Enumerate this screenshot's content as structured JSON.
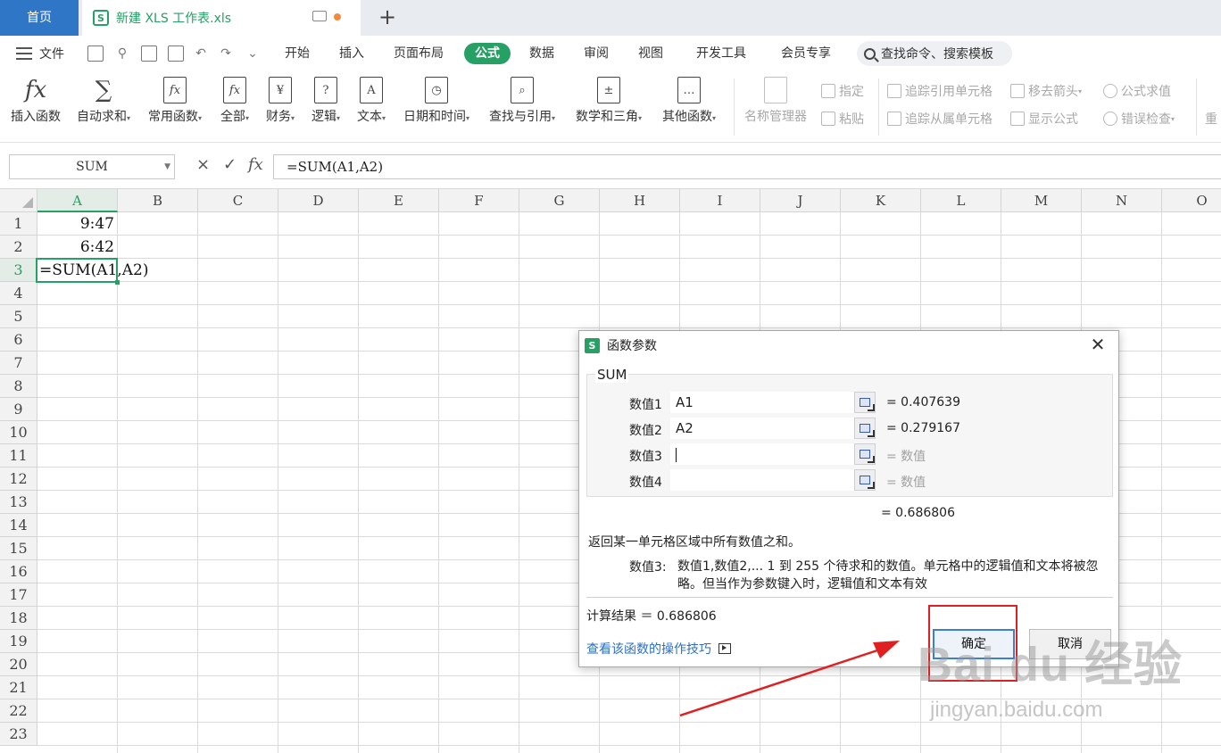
{
  "titlebar": {
    "home_tab": "首页",
    "doc_tab": "新建 XLS 工作表.xls",
    "doc_icon_letter": "S",
    "new_tab_symbol": "+"
  },
  "menu": {
    "file_label": "文件",
    "tabs": [
      "开始",
      "插入",
      "页面布局",
      "公式",
      "数据",
      "审阅",
      "视图",
      "开发工具",
      "会员专享"
    ],
    "active_tab": "公式",
    "search_placeholder": "查找命令、搜索模板"
  },
  "ribbon": {
    "buttons": [
      {
        "label": "插入函数",
        "icon": "fx-icon",
        "glyph": "fx"
      },
      {
        "label": "自动求和",
        "icon": "sigma-icon",
        "glyph": "∑"
      },
      {
        "label": "常用函数",
        "icon": "star-function-icon",
        "glyph": "fx"
      },
      {
        "label": "全部",
        "icon": "function-book-icon",
        "glyph": "fx"
      },
      {
        "label": "财务",
        "icon": "yen-book-icon",
        "glyph": "¥"
      },
      {
        "label": "逻辑",
        "icon": "question-book-icon",
        "glyph": "?"
      },
      {
        "label": "文本",
        "icon": "text-book-icon",
        "glyph": "A"
      },
      {
        "label": "日期和时间",
        "icon": "clock-book-icon",
        "glyph": "◷"
      },
      {
        "label": "查找与引用",
        "icon": "magnifier-book-icon",
        "glyph": "⌕"
      },
      {
        "label": "数学和三角",
        "icon": "math-book-icon",
        "glyph": "±"
      },
      {
        "label": "其他函数",
        "icon": "dots-book-icon",
        "glyph": "…"
      }
    ],
    "name_manager": "名称管理器",
    "specify": "指定",
    "paste": "粘贴",
    "trace_precedents": "追踪引用单元格",
    "trace_dependents": "追踪从属单元格",
    "remove_arrows": "移去箭头",
    "show_formulas": "显示公式",
    "evaluate_formula": "公式求值",
    "error_check": "错误检查",
    "recalc_partial": "重"
  },
  "formula_bar": {
    "name_box": "SUM",
    "cancel_symbol": "×",
    "confirm_symbol": "✓",
    "fx_symbol": "fx",
    "formula": "=SUM(A1,A2)"
  },
  "sheet": {
    "columns": [
      "A",
      "B",
      "C",
      "D",
      "E",
      "F",
      "G",
      "H",
      "I",
      "J",
      "K",
      "L",
      "M",
      "N",
      "O"
    ],
    "rows": [
      "1",
      "2",
      "3",
      "4",
      "5",
      "6",
      "7",
      "8",
      "9",
      "10",
      "11",
      "12",
      "13",
      "14",
      "15",
      "16",
      "17",
      "18",
      "19",
      "20",
      "21",
      "22",
      "23"
    ],
    "cells": {
      "A1": "9:47",
      "A2": "6:42",
      "A3": "=SUM(A1,A2)"
    }
  },
  "dialog": {
    "title": "函数参数",
    "function_name": "SUM",
    "args": [
      {
        "label": "数值1",
        "value": "A1",
        "result": "= 0.407639"
      },
      {
        "label": "数值2",
        "value": "A2",
        "result": "= 0.279167"
      },
      {
        "label": "数值3",
        "value": "",
        "result": "= 数值"
      },
      {
        "label": "数值4",
        "value": "",
        "result": "= 数值"
      }
    ],
    "total": "= 0.686806",
    "description": "返回某一单元格区域中所有数值之和。",
    "help_label": "数值3:",
    "help_text": "数值1,数值2,... 1 到 255 个待求和的数值。单元格中的逻辑值和文本将被忽略。但当作为参数键入时，逻辑值和文本有效",
    "calc_result": "计算结果 ＝ 0.686806",
    "tips_link": "查看该函数的操作技巧",
    "ok_button": "确定",
    "cancel_button": "取消"
  },
  "watermark": {
    "brand": "Bai du 经验",
    "url": "jingyan.baidu.com"
  },
  "colors": {
    "accent_green": "#27a065",
    "home_tab_blue": "#2f77c6",
    "annotation_red": "#e02020",
    "link_blue": "#2e6fc4"
  }
}
